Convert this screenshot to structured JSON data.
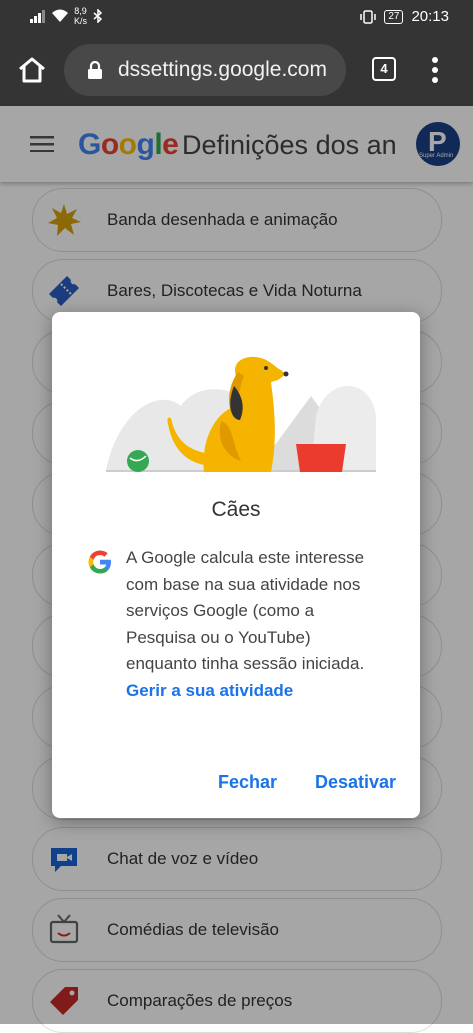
{
  "status_bar": {
    "speed_value": "8,9",
    "speed_unit": "K/s",
    "battery": "27",
    "time": "20:13"
  },
  "browser": {
    "url": "dssettings.google.com",
    "tab_count": "4"
  },
  "app_header": {
    "logo": "Google",
    "title": "Definições dos an",
    "avatar_letter": "P",
    "avatar_sub": "Super Admin"
  },
  "categories": [
    {
      "label": "Banda desenhada e animação",
      "icon": "star-burst-icon",
      "color": "#d5a20a"
    },
    {
      "label": "Bares, Discotecas e Vida Noturna",
      "icon": "ticket-icon",
      "color": "#2c5cc5"
    },
    {
      "label": "Chat de voz e vídeo",
      "icon": "chat-bubble-icon",
      "color": "#1a63d6"
    },
    {
      "label": "Comédias de televisão",
      "icon": "tv-icon",
      "color": "#666666"
    },
    {
      "label": "Comparações de preços",
      "icon": "price-tag-icon",
      "color": "#c62828"
    }
  ],
  "dialog": {
    "title": "Cães",
    "body": "A Google calcula este interesse com base na sua atividade nos serviços Google (como a Pesquisa ou o YouTube) enquanto tinha sessão iniciada.",
    "link": "Gerir a sua atividade",
    "close_label": "Fechar",
    "disable_label": "Desativar"
  }
}
